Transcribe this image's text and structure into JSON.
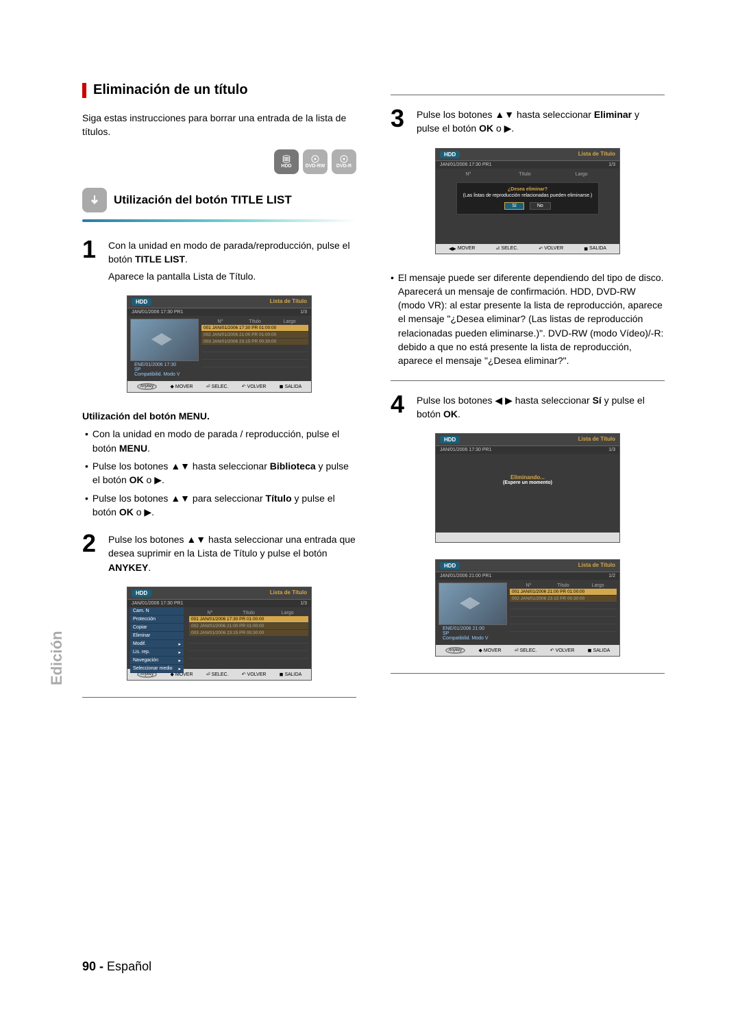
{
  "page": {
    "side_tab": "Edición",
    "number": "90 -",
    "lang": "Español"
  },
  "section": {
    "title": "Eliminación de un título",
    "intro": "Siga estas instrucciones para borrar una entrada de la lista de títulos.",
    "disc_labels": {
      "hdd": "HDD",
      "rw": "DVD-RW",
      "r": "DVD-R"
    },
    "sub_title": "Utilización del botón TITLE LIST"
  },
  "steps": {
    "s1": {
      "num": "1",
      "p1a": "Con la unidad en modo de parada/reproducción, pulse el botón ",
      "p1b": "TITLE LIST",
      "p1c": ".",
      "p2": "Aparece la pantalla Lista de Título."
    },
    "menu_block": {
      "title": "Utilización del botón MENU.",
      "li1a": "Con la unidad en modo de parada / reproducción, pulse el botón ",
      "li1b": "MENU",
      "li1c": ".",
      "li2a": "Pulse los botones ▲▼ hasta seleccionar ",
      "li2b": "Biblioteca",
      "li2c": " y pulse el botón ",
      "li2d": "OK",
      "li2e": " o ▶.",
      "li3a": "Pulse los botones ▲▼ para seleccionar ",
      "li3b": "Título",
      "li3c": " y pulse el botón ",
      "li3d": "OK",
      "li3e": " o ▶."
    },
    "s2": {
      "num": "2",
      "p1a": "Pulse los botones ▲▼ hasta seleccionar una entrada que desea suprimir en la Lista de Título y pulse el botón ",
      "p1b": "ANYKEY",
      "p1c": "."
    },
    "s3": {
      "num": "3",
      "p1a": "Pulse los botones ▲▼ hasta seleccionar ",
      "p1b": "Eliminar",
      "p1c": " y pulse el botón ",
      "p1d": "OK",
      "p1e": " o ▶."
    },
    "info3": "El mensaje puede ser diferente dependiendo del tipo de disco. Aparecerá un mensaje de confirmación. HDD, DVD-RW (modo VR): al estar presente la lista de reproducción, aparece el mensaje \"¿Desea eliminar? (Las listas de reproducción relacionadas pueden eliminarse.)\". DVD-RW (modo Vídeo)/-R: debido a que no está presente la lista de reproducción, aparece el mensaje \"¿Desea eliminar?\".",
    "s4": {
      "num": "4",
      "p1a": "Pulse los botones ◀ ▶ hasta seleccionar ",
      "p1b": "Sí",
      "p1c": " y pulse el botón ",
      "p1d": "OK",
      "p1e": "."
    }
  },
  "ui": {
    "hdd": "HDD",
    "title_list": "Lista de Título",
    "date1": "JAN/01/2006 17:30 PR1",
    "count3": "1/3",
    "count2": "1/2",
    "cols": {
      "no": "Nº",
      "title": "Título",
      "length": "Largo"
    },
    "rows3": [
      "001  JAN/01/2006 17:30 PR  01:00:00",
      "002  JAN/01/2006 21:00 PR  01:00:00",
      "003  JAN/01/2006 23:15 PR  00:30:00"
    ],
    "rows2": [
      "001  JAN/01/2006 21:00 PR  01:00:00",
      "002  JAN/01/2006 23:15 PR  00:30:00"
    ],
    "info_left": {
      "date": "ENE/01/2006 17:30",
      "sp": "SP",
      "compat": "Compatibilid. Modo V"
    },
    "info_left5": {
      "date": "ENE/01/2006 21:00",
      "sp": "SP",
      "compat": "Compatibilid. Modo V"
    },
    "date5": "JAN/01/2006 21:00 PR1",
    "menu": [
      "Cam. N",
      "Protección",
      "Copiar",
      "Eliminar",
      "Modif.",
      "Lis. rep.",
      "Navegación",
      "Seleccionar medio"
    ],
    "menu_sub_idx": [
      4,
      5,
      6,
      7
    ],
    "dialog": {
      "q": "¿Desea eliminar?",
      "msg": "(Las listas de reproducción relacionadas pueden eliminarse.)",
      "yes": "Sí",
      "no": "No"
    },
    "deleting": {
      "title": "Eliminando...",
      "msg": "(Espere un momento)"
    },
    "footer": {
      "anykey": "Anykey",
      "mover": "MOVER",
      "selec": "SELEC.",
      "volver": "VOLVER",
      "salida": "SALIDA"
    }
  }
}
